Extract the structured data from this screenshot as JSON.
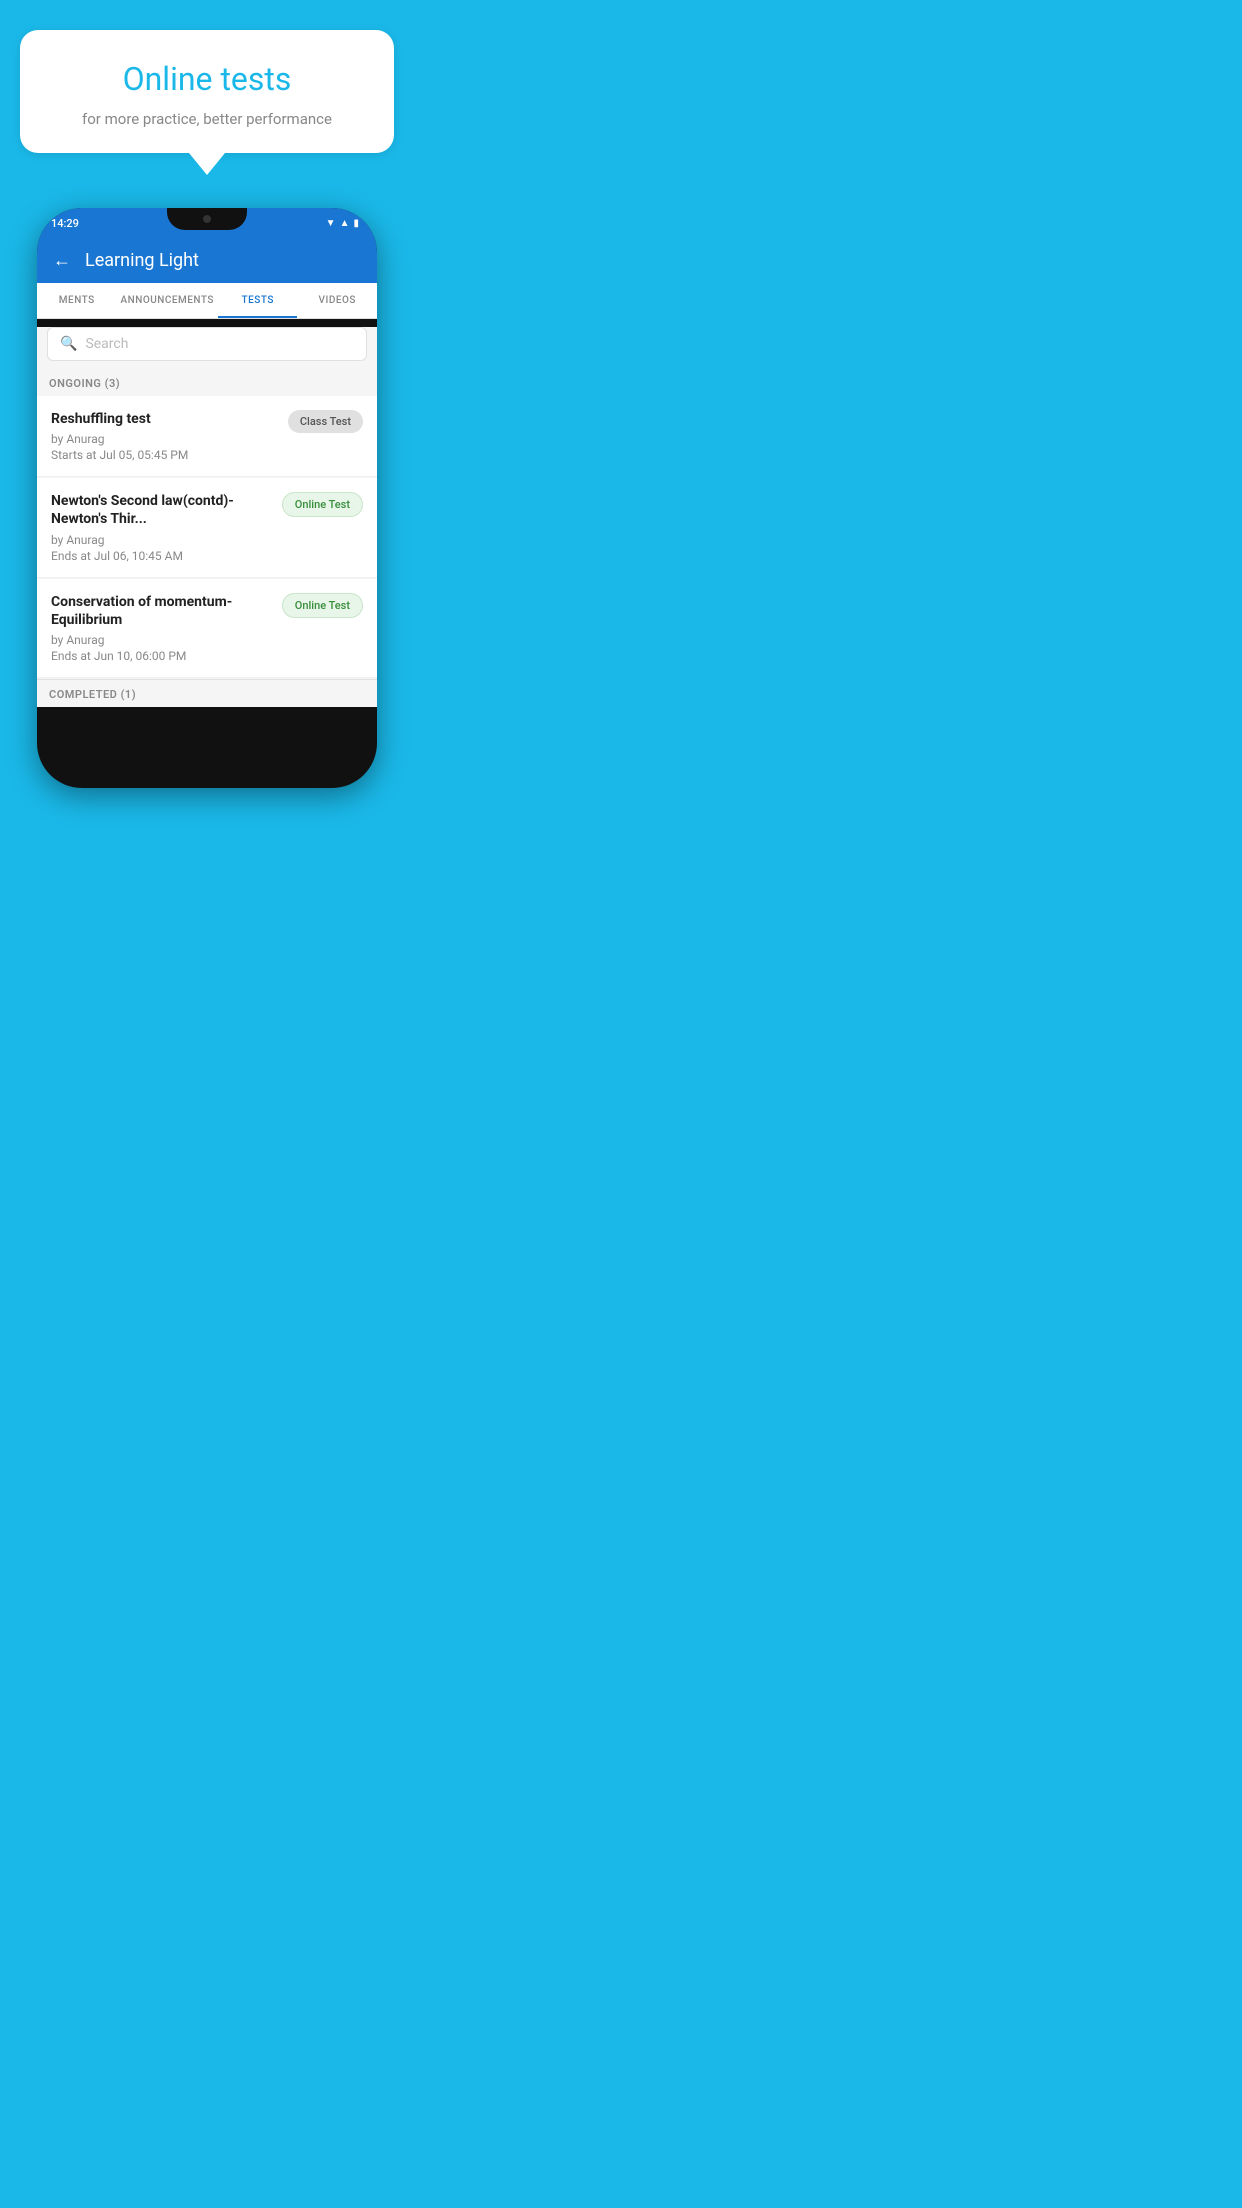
{
  "background_color": "#1ab8e8",
  "speech_bubble": {
    "title": "Online tests",
    "subtitle": "for more practice, better performance"
  },
  "phone": {
    "status_bar": {
      "time": "14:29",
      "icons": [
        "wifi",
        "signal",
        "battery"
      ]
    },
    "header": {
      "back_label": "←",
      "title": "Learning Light"
    },
    "tabs": [
      {
        "label": "MENTS",
        "active": false
      },
      {
        "label": "ANNOUNCEMENTS",
        "active": false
      },
      {
        "label": "TESTS",
        "active": true
      },
      {
        "label": "VIDEOS",
        "active": false
      }
    ],
    "search": {
      "placeholder": "Search"
    },
    "sections": [
      {
        "header": "ONGOING (3)",
        "items": [
          {
            "name": "Reshuffling test",
            "by": "by Anurag",
            "date_label": "Starts at",
            "date": "Jul 05, 05:45 PM",
            "badge": "Class Test",
            "badge_type": "class"
          },
          {
            "name": "Newton's Second law(contd)-Newton's Thir...",
            "by": "by Anurag",
            "date_label": "Ends at",
            "date": "Jul 06, 10:45 AM",
            "badge": "Online Test",
            "badge_type": "online"
          },
          {
            "name": "Conservation of momentum-Equilibrium",
            "by": "by Anurag",
            "date_label": "Ends at",
            "date": "Jun 10, 06:00 PM",
            "badge": "Online Test",
            "badge_type": "online"
          }
        ]
      },
      {
        "header": "COMPLETED (1)",
        "items": []
      }
    ]
  }
}
